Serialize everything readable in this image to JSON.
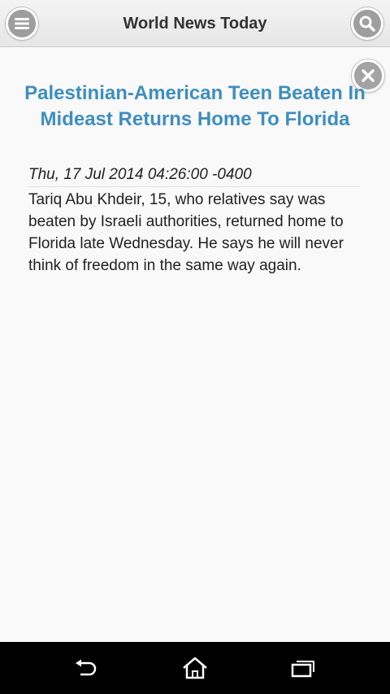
{
  "header": {
    "title": "World News Today",
    "menu_icon": "menu-icon",
    "search_icon": "search-icon"
  },
  "article": {
    "close_icon": "close-icon",
    "title": "Palestinian-American Teen Beaten In Mideast Returns Home To Florida",
    "date": "Thu, 17 Jul 2014 04:26:00 -0400",
    "body": "Tariq Abu Khdeir, 15, who relatives say was beaten by Israeli authorities, returned home to Florida late Wednesday. He says he will never think of freedom in the same way again."
  },
  "navbar": {
    "back_icon": "back-icon",
    "home_icon": "home-icon",
    "recent_icon": "recent-apps-icon"
  },
  "colors": {
    "title_blue": "#3e8ebf",
    "header_bg": "#ececec",
    "button_gray": "#9e9e9e",
    "navbar_bg": "#000000"
  }
}
